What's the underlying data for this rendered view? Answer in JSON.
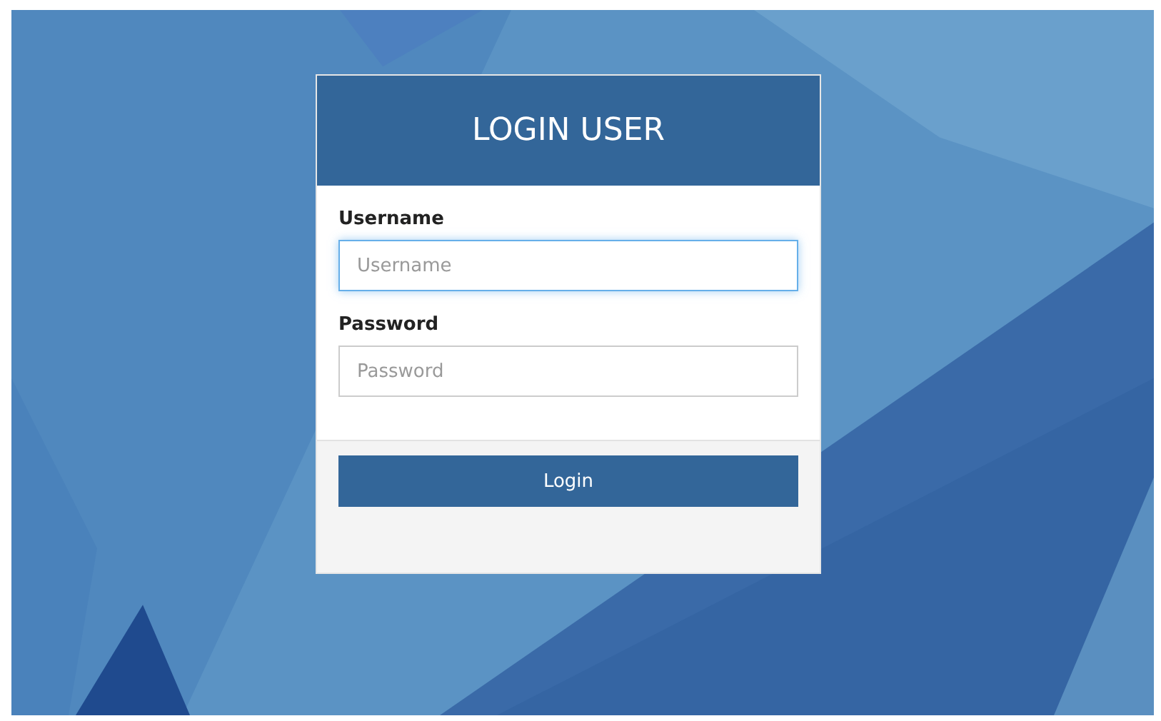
{
  "login_card": {
    "title": "LOGIN USER",
    "fields": [
      {
        "label": "Username",
        "placeholder": "Username",
        "focused": true
      },
      {
        "label": "Password",
        "placeholder": "Password",
        "focused": false
      }
    ],
    "button": "Login"
  }
}
